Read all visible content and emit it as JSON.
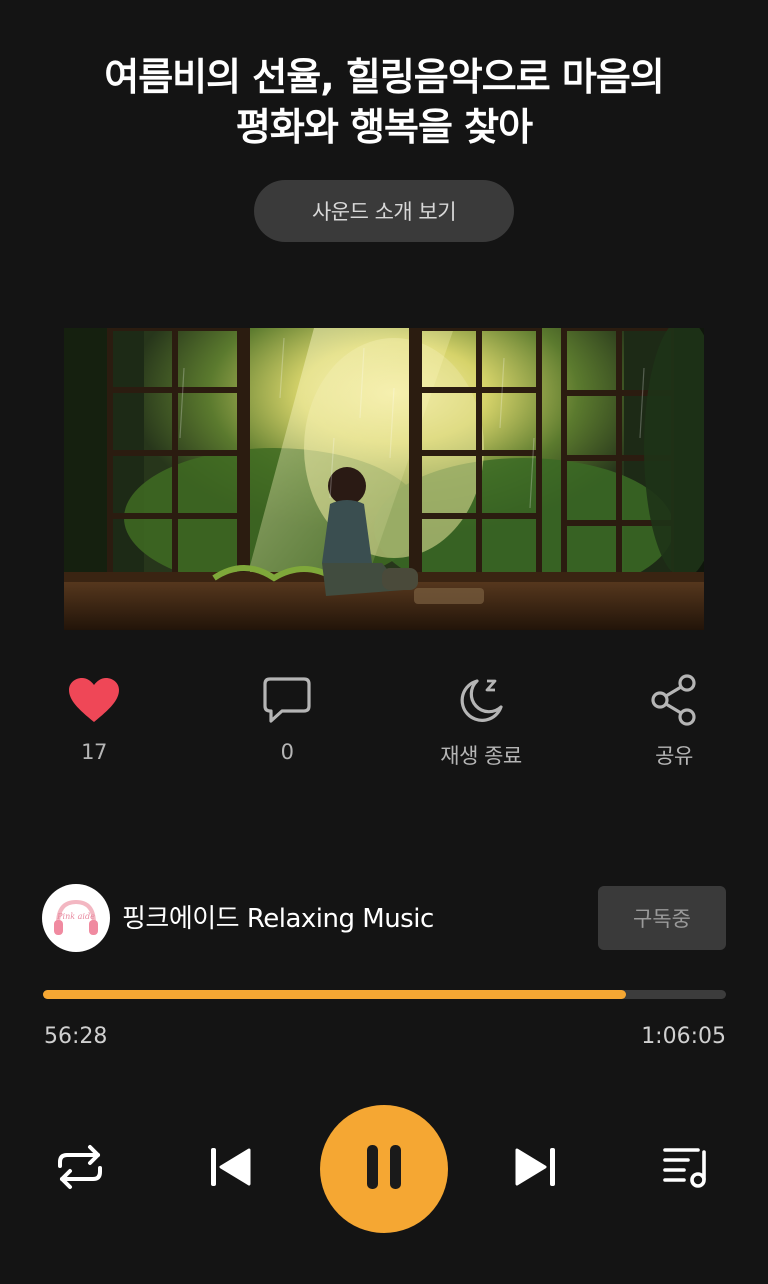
{
  "header": {
    "title_line1": "여름비의 선율, 힐링음악으로 마음의",
    "title_line2": "평화와 행복을 찾아",
    "intro_button_label": "사운드 소개 보기"
  },
  "actions": {
    "like_count": "17",
    "comment_count": "0",
    "sleep_timer_label": "재생 종료",
    "share_label": "공유"
  },
  "channel": {
    "name": "핑크에이드 Relaxing Music",
    "avatar_text": "Pink aide",
    "subscribe_label": "구독중"
  },
  "playback": {
    "current_time": "56:28",
    "total_time": "1:06:05",
    "progress": 0.854,
    "state": "playing"
  },
  "colors": {
    "accent": "#f5a733",
    "like": "#ef4757",
    "background": "#141414"
  },
  "icons": {
    "like": "heart-icon",
    "comment": "comment-icon",
    "sleep_timer": "moon-icon",
    "share": "share-icon",
    "repeat": "repeat-icon",
    "previous": "skip-previous-icon",
    "pause": "pause-icon",
    "next": "skip-next-icon",
    "playlist": "playlist-icon"
  }
}
